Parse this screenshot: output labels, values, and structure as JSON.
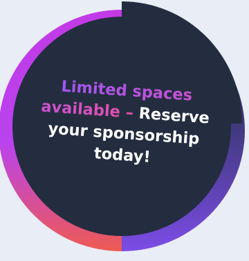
{
  "badge": {
    "highlight": "Limited spaces available –",
    "text": " Reserve your sponsorship today!"
  },
  "colors": {
    "page_background": "#e9edf6",
    "circle_fill": "#232d3f",
    "ring_left_top": "#c23ae6",
    "ring_left_mid": "#b943ee",
    "ring_left_bottom": "#ee5a52",
    "ring_right_top": "#2c2f55",
    "ring_right_bottom": "#7c4ce6",
    "text_gradient_start": "#9f56ee",
    "text_gradient_end": "#e351a6",
    "text_white": "#ffffff"
  }
}
